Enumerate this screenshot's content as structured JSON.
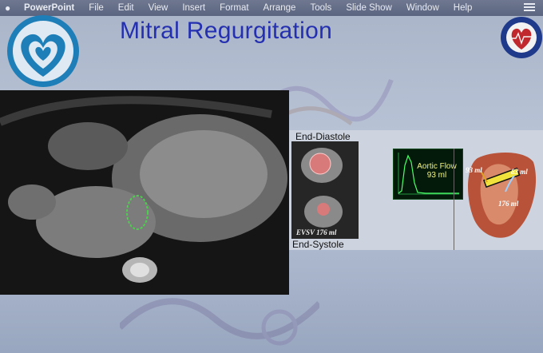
{
  "menubar": {
    "app_name": "PowerPoint",
    "items": [
      "File",
      "Edit",
      "View",
      "Insert",
      "Format",
      "Arrange",
      "Tools",
      "Slide Show",
      "Window",
      "Help"
    ]
  },
  "slide": {
    "title": "Mitral Regurgitation",
    "panel": {
      "label_top": "End-Diastole",
      "label_bottom": "End-Systole",
      "esv_caption": "EVSV 176 ml",
      "flow_title": "Aortic Flow",
      "flow_value": "93 ml",
      "heart_labels": [
        "93 ml",
        "83 ml",
        "176 ml"
      ]
    }
  },
  "colors": {
    "title": "#2430b0",
    "menubar": "#5c6580",
    "flow_text": "#f5f57a"
  }
}
